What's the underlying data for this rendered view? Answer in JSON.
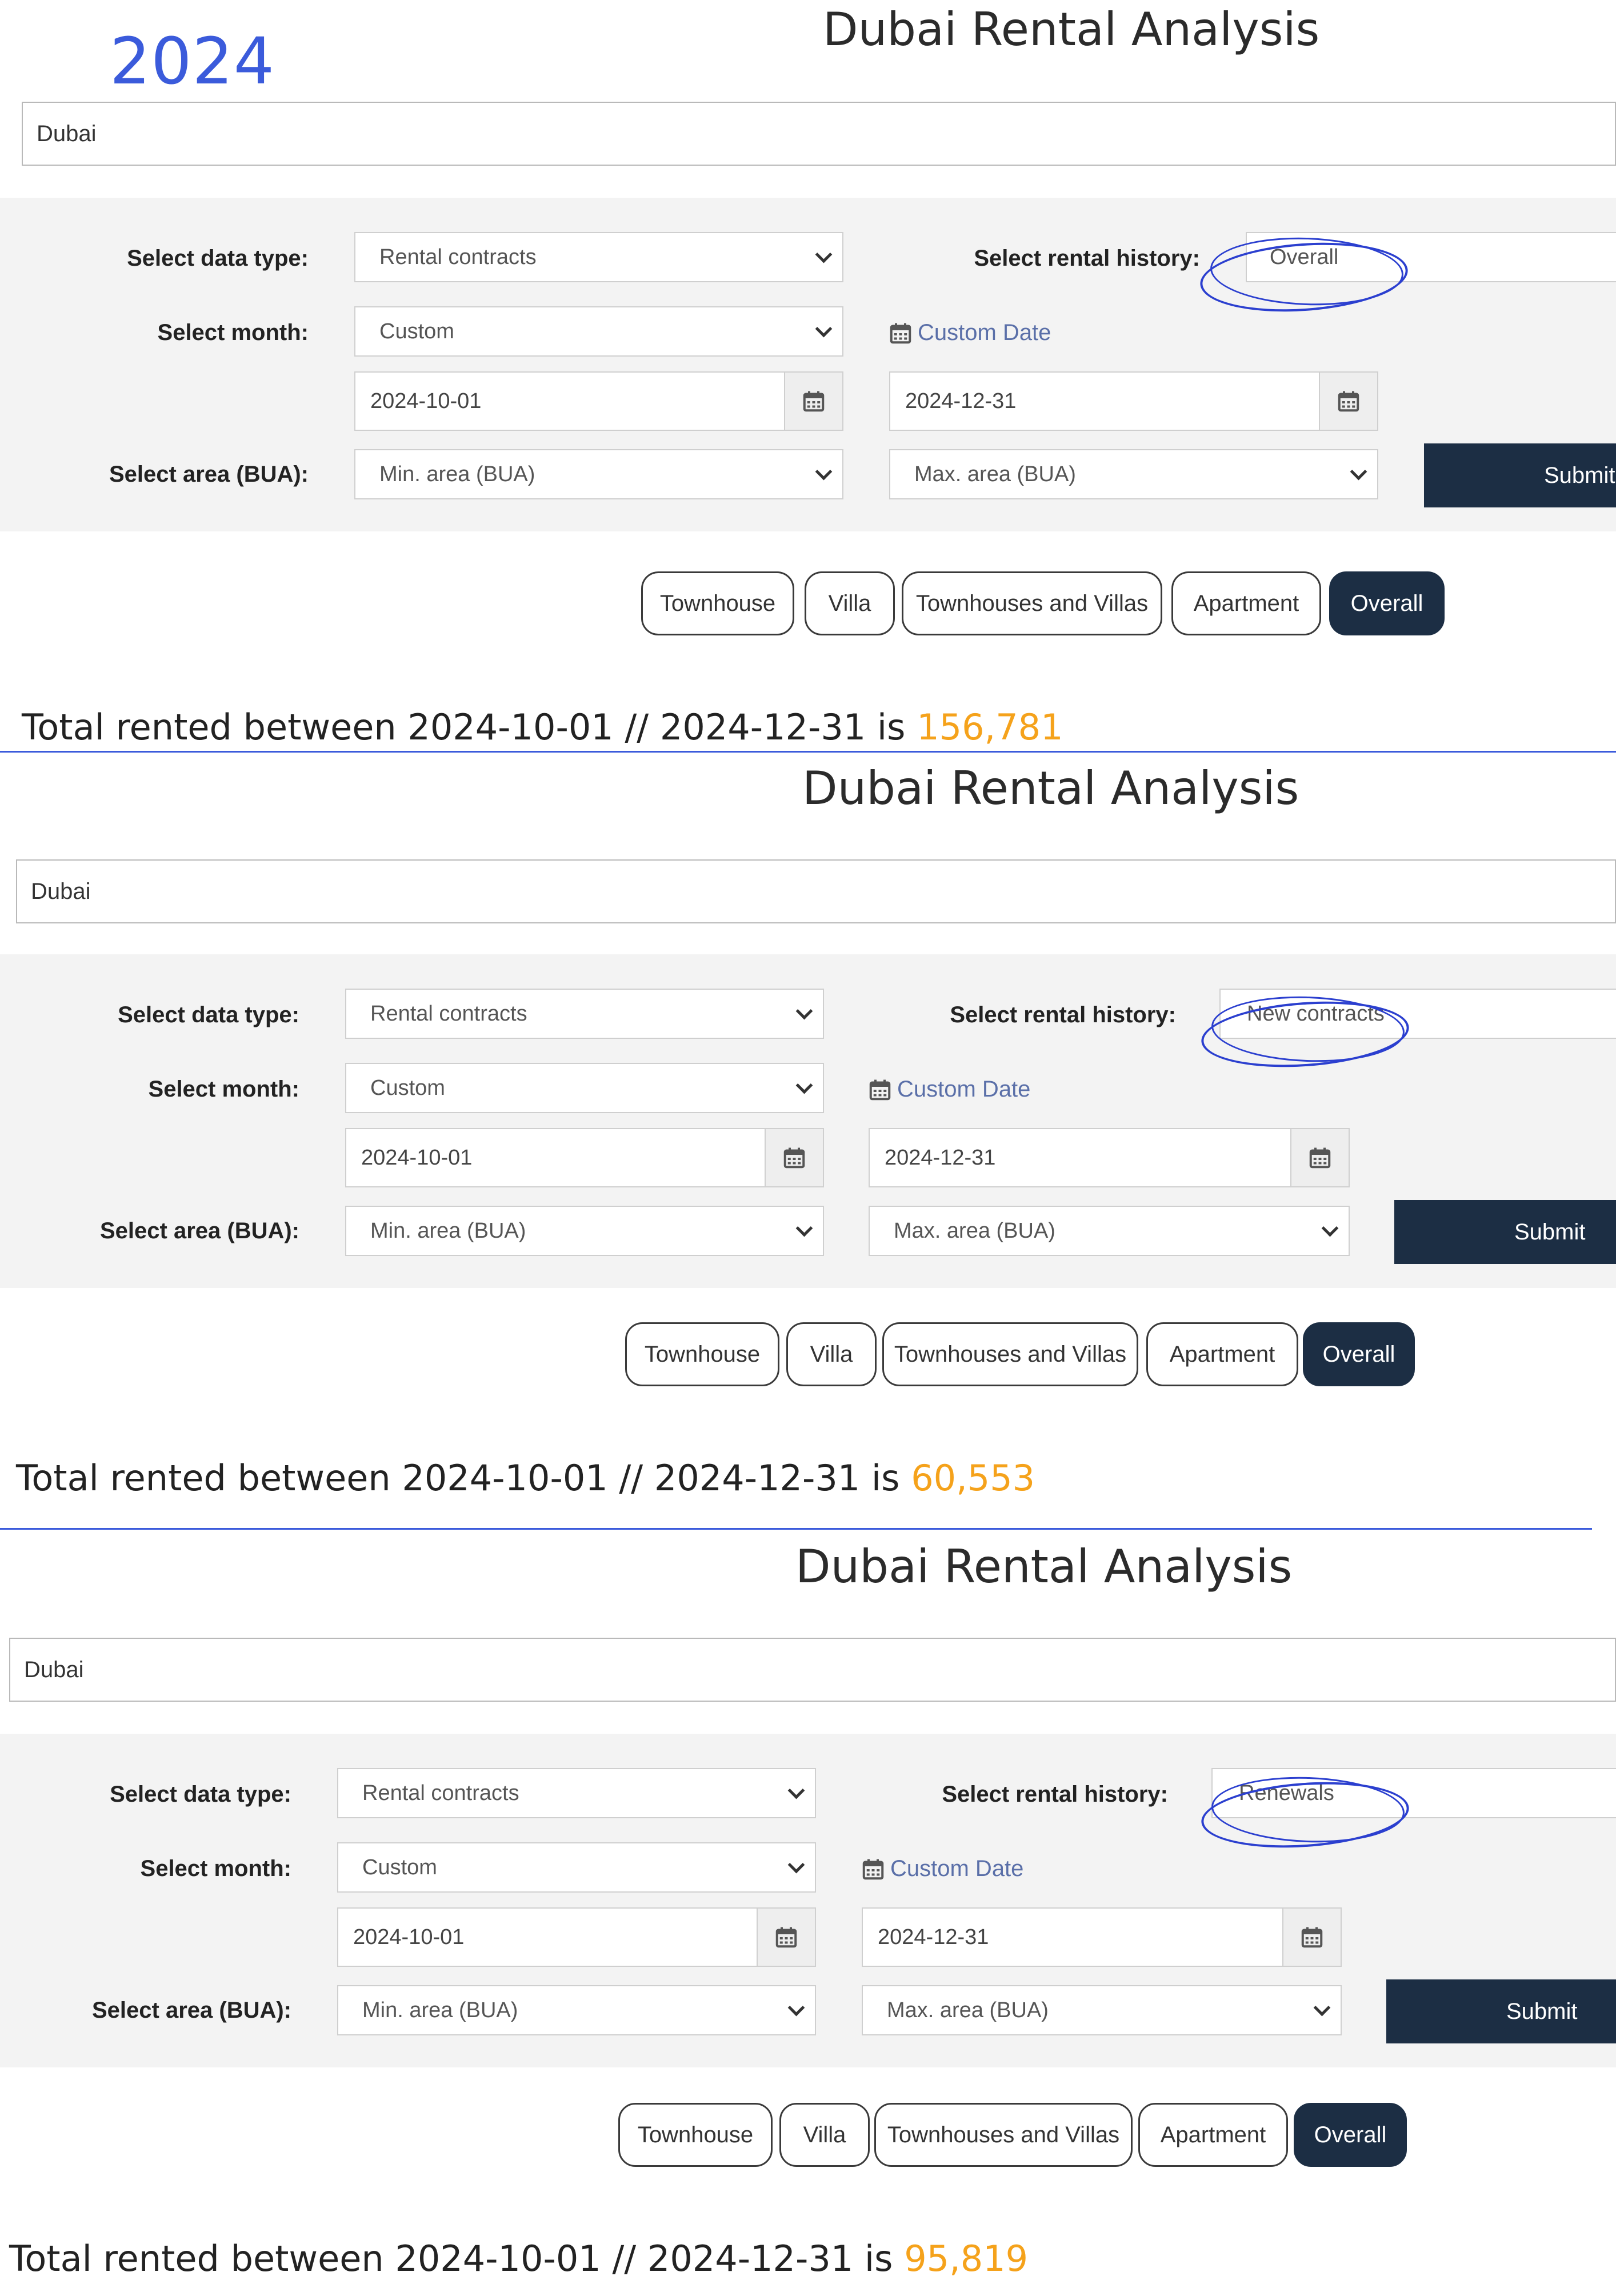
{
  "year_label": "2024",
  "panels": [
    {
      "title": "Dubai Rental Analysis",
      "search_value": "Dubai",
      "data_type_label": "Select data type:",
      "data_type_value": "Rental contracts",
      "rental_history_label": "Select rental history:",
      "rental_history_value": "Overall",
      "month_label": "Select month:",
      "month_value": "Custom",
      "custom_date_link": "Custom Date",
      "start_date": "2024-10-01",
      "end_date": "2024-12-31",
      "area_label": "Select area (BUA):",
      "min_area": "Min. area (BUA)",
      "max_area": "Max. area (BUA)",
      "submit_label": "Submit",
      "property_types": [
        "Townhouse",
        "Villa",
        "Townhouses and Villas",
        "Apartment",
        "Overall"
      ],
      "active_type": "Overall",
      "total_prefix": "Total rented between 2024-10-01 // 2024-12-31 is",
      "total_value": "156,781"
    },
    {
      "title": "Dubai Rental Analysis",
      "search_value": "Dubai",
      "data_type_label": "Select data type:",
      "data_type_value": "Rental contracts",
      "rental_history_label": "Select rental history:",
      "rental_history_value": "New contracts",
      "month_label": "Select month:",
      "month_value": "Custom",
      "custom_date_link": "Custom Date",
      "start_date": "2024-10-01",
      "end_date": "2024-12-31",
      "area_label": "Select area (BUA):",
      "min_area": "Min. area (BUA)",
      "max_area": "Max. area (BUA)",
      "submit_label": "Submit",
      "property_types": [
        "Townhouse",
        "Villa",
        "Townhouses and Villas",
        "Apartment",
        "Overall"
      ],
      "active_type": "Overall",
      "total_prefix": "Total rented between 2024-10-01 // 2024-12-31 is",
      "total_value": "60,553"
    },
    {
      "title": "Dubai Rental Analysis",
      "search_value": "Dubai",
      "data_type_label": "Select data type:",
      "data_type_value": "Rental contracts",
      "rental_history_label": "Select rental history:",
      "rental_history_value": "Renewals",
      "month_label": "Select month:",
      "month_value": "Custom",
      "custom_date_link": "Custom Date",
      "start_date": "2024-10-01",
      "end_date": "2024-12-31",
      "area_label": "Select area (BUA):",
      "min_area": "Min. area (BUA)",
      "max_area": "Max. area (BUA)",
      "submit_label": "Submit",
      "property_types": [
        "Townhouse",
        "Villa",
        "Townhouses and Villas",
        "Apartment",
        "Overall"
      ],
      "active_type": "Overall",
      "total_prefix": "Total rented between 2024-10-01 // 2024-12-31 is",
      "total_value": "95,819"
    }
  ],
  "colors": {
    "accent_blue": "#3b5bdb",
    "navy": "#1c2e44",
    "total_orange": "#f5a21b",
    "link": "#5a6fa8"
  },
  "icons": [
    "calendar-icon",
    "chevron-down-icon"
  ]
}
